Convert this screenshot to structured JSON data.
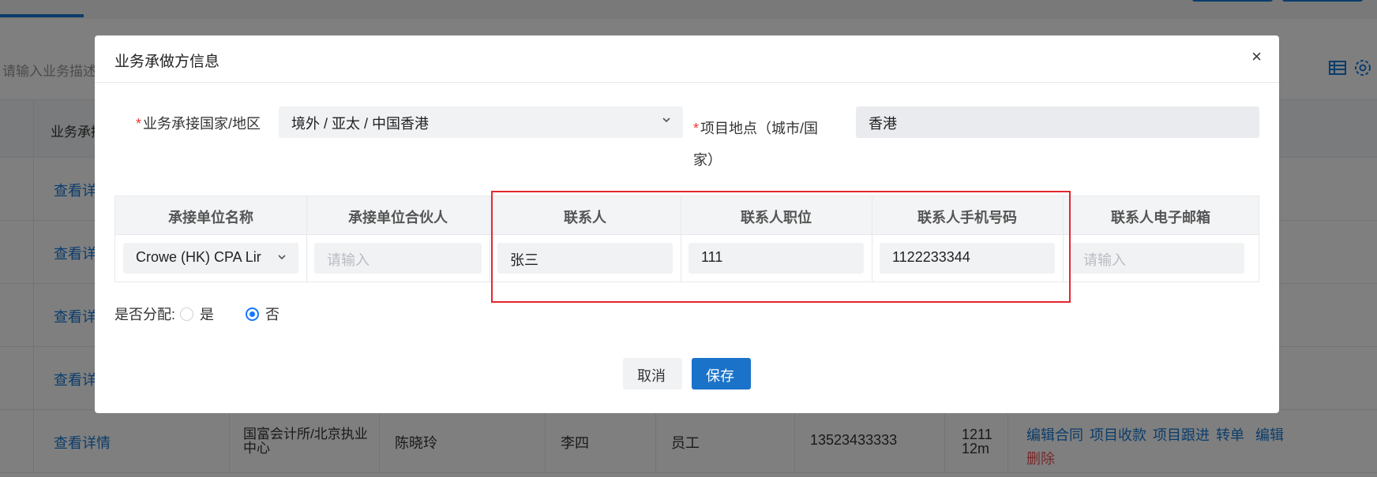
{
  "background": {
    "search_placeholder": "请输入业务描述",
    "table_header_first": "业务承接",
    "rows": [
      {
        "link": "查看详"
      },
      {
        "link": "查看详"
      },
      {
        "link": "查看详"
      },
      {
        "link": "查看详"
      },
      {
        "link": "查看详情",
        "unit": "国富会计所/北京执业中心",
        "partner": "陈晓玲",
        "contact": "李四",
        "position": "员工",
        "phone": "13523433333",
        "email_partial": "121112m"
      }
    ],
    "actions": [
      "编辑合同",
      "项目收款",
      "项目跟进",
      "转单",
      "编辑"
    ],
    "delete_label": "删除"
  },
  "modal": {
    "title": "业务承做方信息",
    "close": "×",
    "country_label": "业务承接国家/地区",
    "country_value": "境外 / 亚太 / 中国香港",
    "location_label_1": "项目地点（城市/国",
    "location_label_2": "家）",
    "location_value": "香港",
    "table": {
      "headers": [
        "承接单位名称",
        "承接单位合伙人",
        "联系人",
        "联系人职位",
        "联系人手机号码",
        "联系人电子邮箱"
      ],
      "unit_value": "Crowe (HK) CPA Lir",
      "partner_placeholder": "请输入",
      "contact_value": "张三",
      "position_value": "111",
      "phone_value": "1122233344",
      "email_placeholder": "请输入"
    },
    "allocate_label": "是否分配:",
    "radio_yes": "是",
    "radio_no": "否",
    "radio_selected": "否",
    "cancel_label": "取消",
    "save_label": "保存"
  },
  "colors": {
    "primary": "#1a73c8",
    "highlight": "#e4262f"
  }
}
